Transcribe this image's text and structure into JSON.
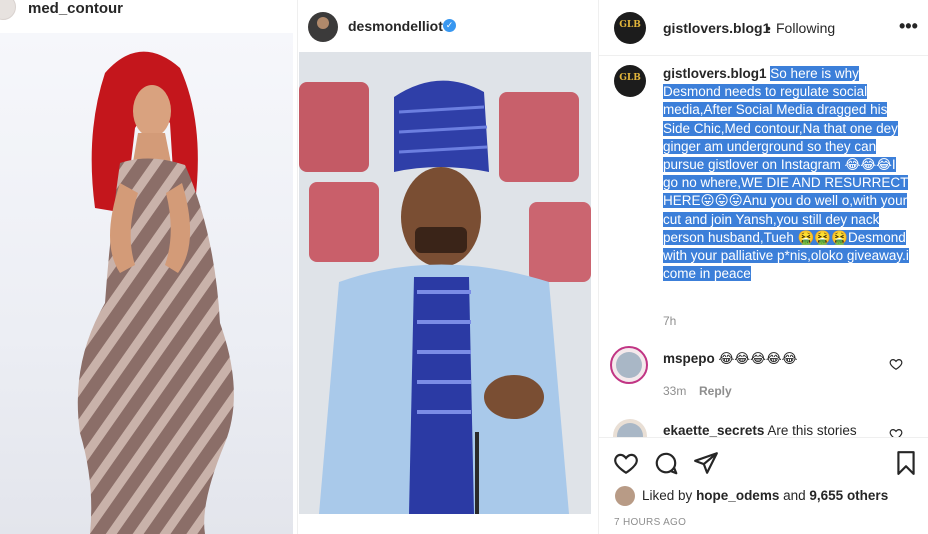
{
  "left_post": {
    "username": "med_contour"
  },
  "middle_post": {
    "username": "desmondelliot",
    "verified_glyph": "✓"
  },
  "right_post": {
    "header": {
      "avatar_text": "GLB",
      "username": "gistlovers.blog1",
      "separator": "•",
      "follow_status": "Following",
      "more_icon": "•••"
    },
    "caption": {
      "username": "gistlovers.blog1",
      "text": "So here is why Desmond needs to regulate social media,After Social Media dragged his Side Chic,Med contour,Na that one dey ginger am underground so they can pursue gistlover on Instagram 😂😂😂I go no where,WE DIE AND RESURRECT HERE😛😛😛Anu you do well o,with your cut and join Yansh,you still dey nack person husband,Tueh 🤮🤮🤮Desmond with your palliative p*nis,oloko giveaway.i come in peace",
      "time": "7h"
    },
    "comments": [
      {
        "username": "mspepo",
        "text": "😂😂😂😂😂",
        "time": "33m",
        "reply_label": "Reply"
      },
      {
        "username": "ekaette_secrets",
        "text": "Are this stories"
      }
    ],
    "likes": {
      "prefix": "Liked by",
      "user": "hope_odems",
      "joiner": "and",
      "count_text": "9,655 others"
    },
    "timestamp": "7 HOURS AGO"
  },
  "icons": [
    "heart-icon",
    "comment-icon",
    "share-icon",
    "bookmark-icon",
    "more-icon",
    "verified-icon"
  ],
  "colors": {
    "selection_highlight": "#3c7fd9",
    "secondary_text": "#8e8e8e",
    "verified_blue": "#3897f0"
  }
}
